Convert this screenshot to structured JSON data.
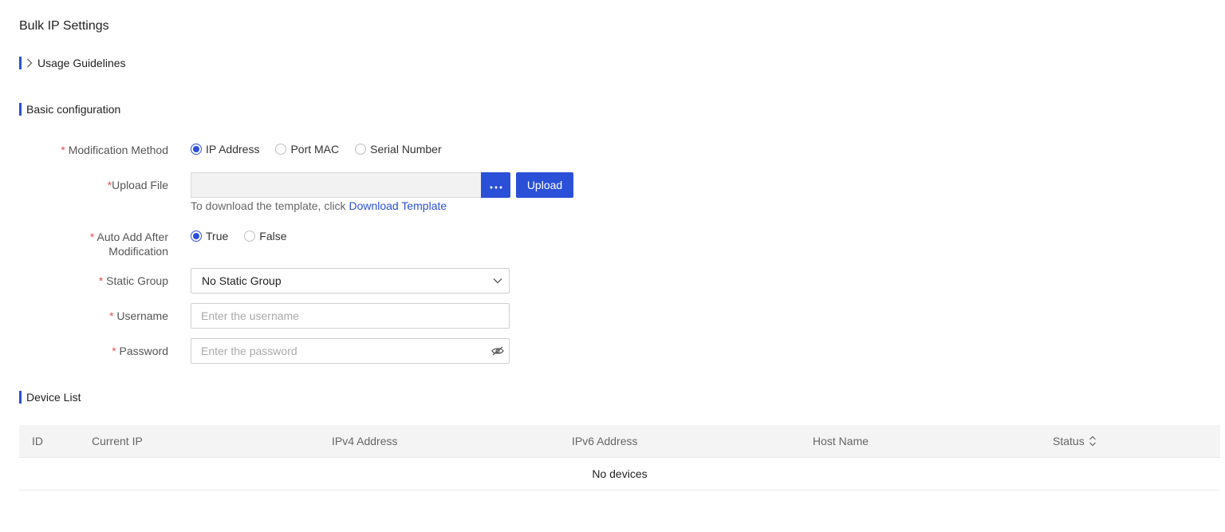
{
  "page": {
    "title": "Bulk IP Settings"
  },
  "sections": {
    "usage": "Usage Guidelines",
    "basic": "Basic configuration",
    "devices": "Device List"
  },
  "form": {
    "required_mark": "*",
    "modification": {
      "label": "Modification Method",
      "options": [
        "IP Address",
        "Port MAC",
        "Serial Number"
      ],
      "selected": "IP Address"
    },
    "upload": {
      "label": "Upload File",
      "browse_icon": "ellipsis-icon",
      "button": "Upload",
      "hint": "To download the template, click ",
      "hint_link": "Download Template"
    },
    "auto_add": {
      "label_line1": "Auto Add After",
      "label_line2": "Modification",
      "options": [
        "True",
        "False"
      ],
      "selected": "True"
    },
    "static_group": {
      "label": "Static Group",
      "value": "No Static Group"
    },
    "username": {
      "label": "Username",
      "placeholder": "Enter the username"
    },
    "password": {
      "label": "Password",
      "placeholder": "Enter the password"
    }
  },
  "table": {
    "columns": [
      "ID",
      "Current IP",
      "IPv4 Address",
      "IPv6 Address",
      "Host Name",
      "Status"
    ],
    "empty_text": "No devices"
  },
  "colors": {
    "accent": "#2b50d8",
    "required": "#e05252"
  }
}
